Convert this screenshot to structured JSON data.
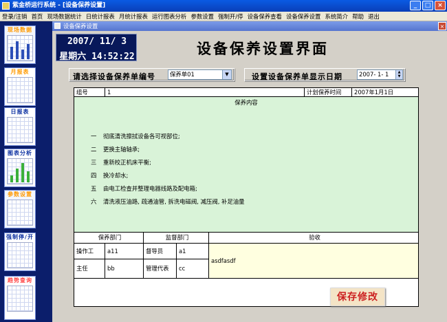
{
  "window": {
    "title": "紫金桥运行系统 - [设备保养设置]",
    "buttons": [
      "_",
      "□",
      "×"
    ]
  },
  "menu": [
    "登录/注销",
    "首页",
    "现场数据统计",
    "日统计报表",
    "月统计报表",
    "运行图表分析",
    "参数设置",
    "强制开/停",
    "设备保养查看",
    "设备保养设置",
    "系统简介",
    "帮助",
    "退出"
  ],
  "sidebar": {
    "items": [
      {
        "label": "现场数据"
      },
      {
        "label": "月报表"
      },
      {
        "label": "日报表"
      },
      {
        "label": "图表分析"
      },
      {
        "label": "参数设置"
      },
      {
        "label": "强制停/开"
      },
      {
        "label": "趋势查询"
      }
    ]
  },
  "inner": {
    "title": "设备保养设置",
    "close": "×"
  },
  "clock": {
    "date": "2007/ 11/  3",
    "weekday_time": "星期六 14:52:22"
  },
  "page": {
    "title": "设备保养设置界面"
  },
  "selector": {
    "label": "请选择设备保养单编号",
    "value": "保养单01",
    "arrow": "▼"
  },
  "display_date": {
    "label": "设置设备保养单显示日期",
    "value": "2007- 1- 1"
  },
  "form": {
    "group_label": "组号",
    "group_value": "1",
    "plan_time_label": "计划保养时间",
    "plan_time_value": "2007年1月1日",
    "content_header": "保养内容",
    "items": [
      {
        "num": "一",
        "text": "彻底清洗擦拭设备各可视部位;"
      },
      {
        "num": "二",
        "text": "更换主轴轴承;"
      },
      {
        "num": "三",
        "text": "重新校正机床平衡;"
      },
      {
        "num": "四",
        "text": "换冷却水;"
      },
      {
        "num": "五",
        "text": "由电工检查并整理电器线路及配电箱;"
      },
      {
        "num": "六",
        "text": "清洗液压油路, 疏通油管, 拆洗电磁阀, 减压阀, 补足油量"
      }
    ],
    "dept_header": "保养部门",
    "supervise_header": "监督部门",
    "accept_header": "验收",
    "operator_label": "操作工",
    "operator_value": "a11",
    "supervisor_label": "督导员",
    "supervisor_value": "a1",
    "director_label": "主任",
    "director_value": "bb",
    "manager_label": "管理代表",
    "manager_value": "cc",
    "accept_value": "asdfasdf"
  },
  "save_button": "保存修改",
  "colors": {
    "title_bar": "#0a4fd6",
    "sidebar": "#0b1e6b",
    "content_bg": "#d9f3d8",
    "accept_bg": "#ffffe0",
    "save_text": "#cc2020"
  }
}
